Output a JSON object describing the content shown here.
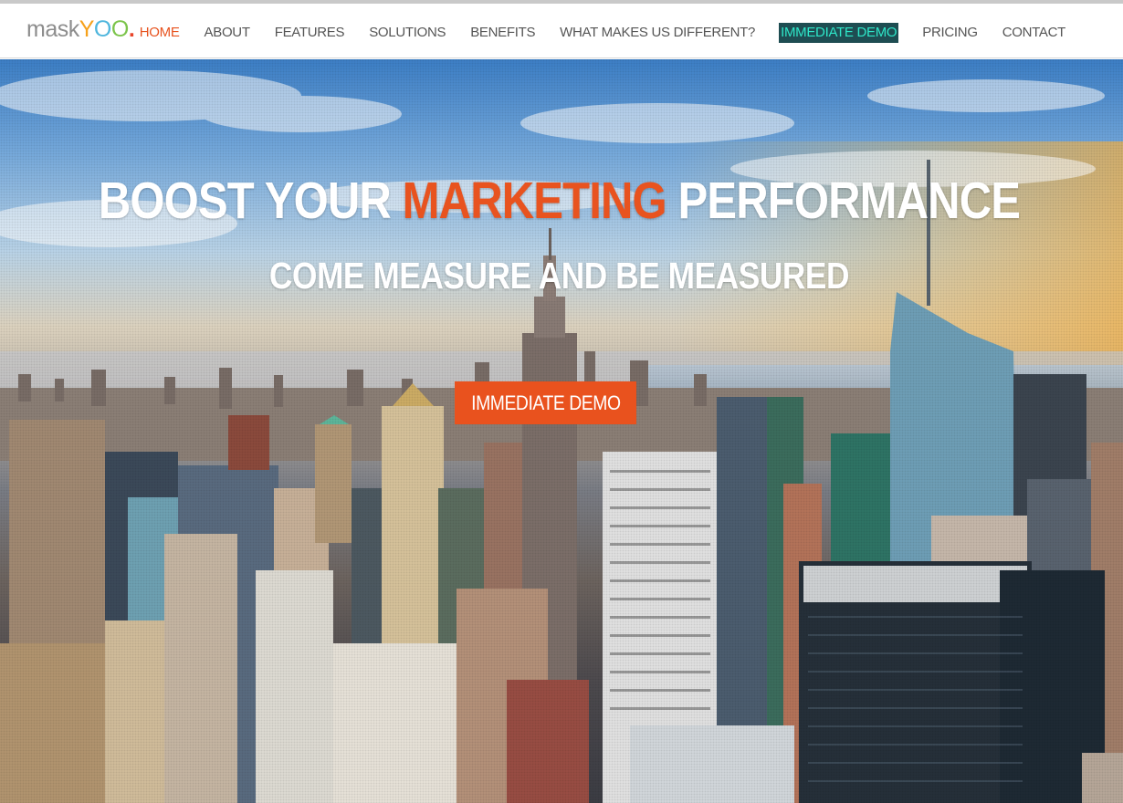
{
  "logo": {
    "mask": "mask",
    "y": "Y",
    "o1": "O",
    "o2": "O",
    "dot": "."
  },
  "nav": {
    "home": "HOME",
    "about": "ABOUT",
    "features": "FEATURES",
    "solutions": "SOLUTIONS",
    "benefits": "BENEFITS",
    "different": "WHAT MAKES US DIFFERENT?",
    "demo": "IMMEDIATE DEMO",
    "pricing": "PRICING",
    "contact": "CONTACT"
  },
  "hero": {
    "headline_before": "BOOST YOUR ",
    "headline_accent": "MARKETING",
    "headline_after": " PERFORMANCE",
    "subheadline": "COME MEASURE AND BE MEASURED",
    "cta_label": "IMMEDIATE DEMO"
  },
  "colors": {
    "accent": "#e8531f",
    "nav_demo_bg": "#1e4d52",
    "nav_demo_text": "#2ee6c8",
    "nav_text": "#555555"
  }
}
